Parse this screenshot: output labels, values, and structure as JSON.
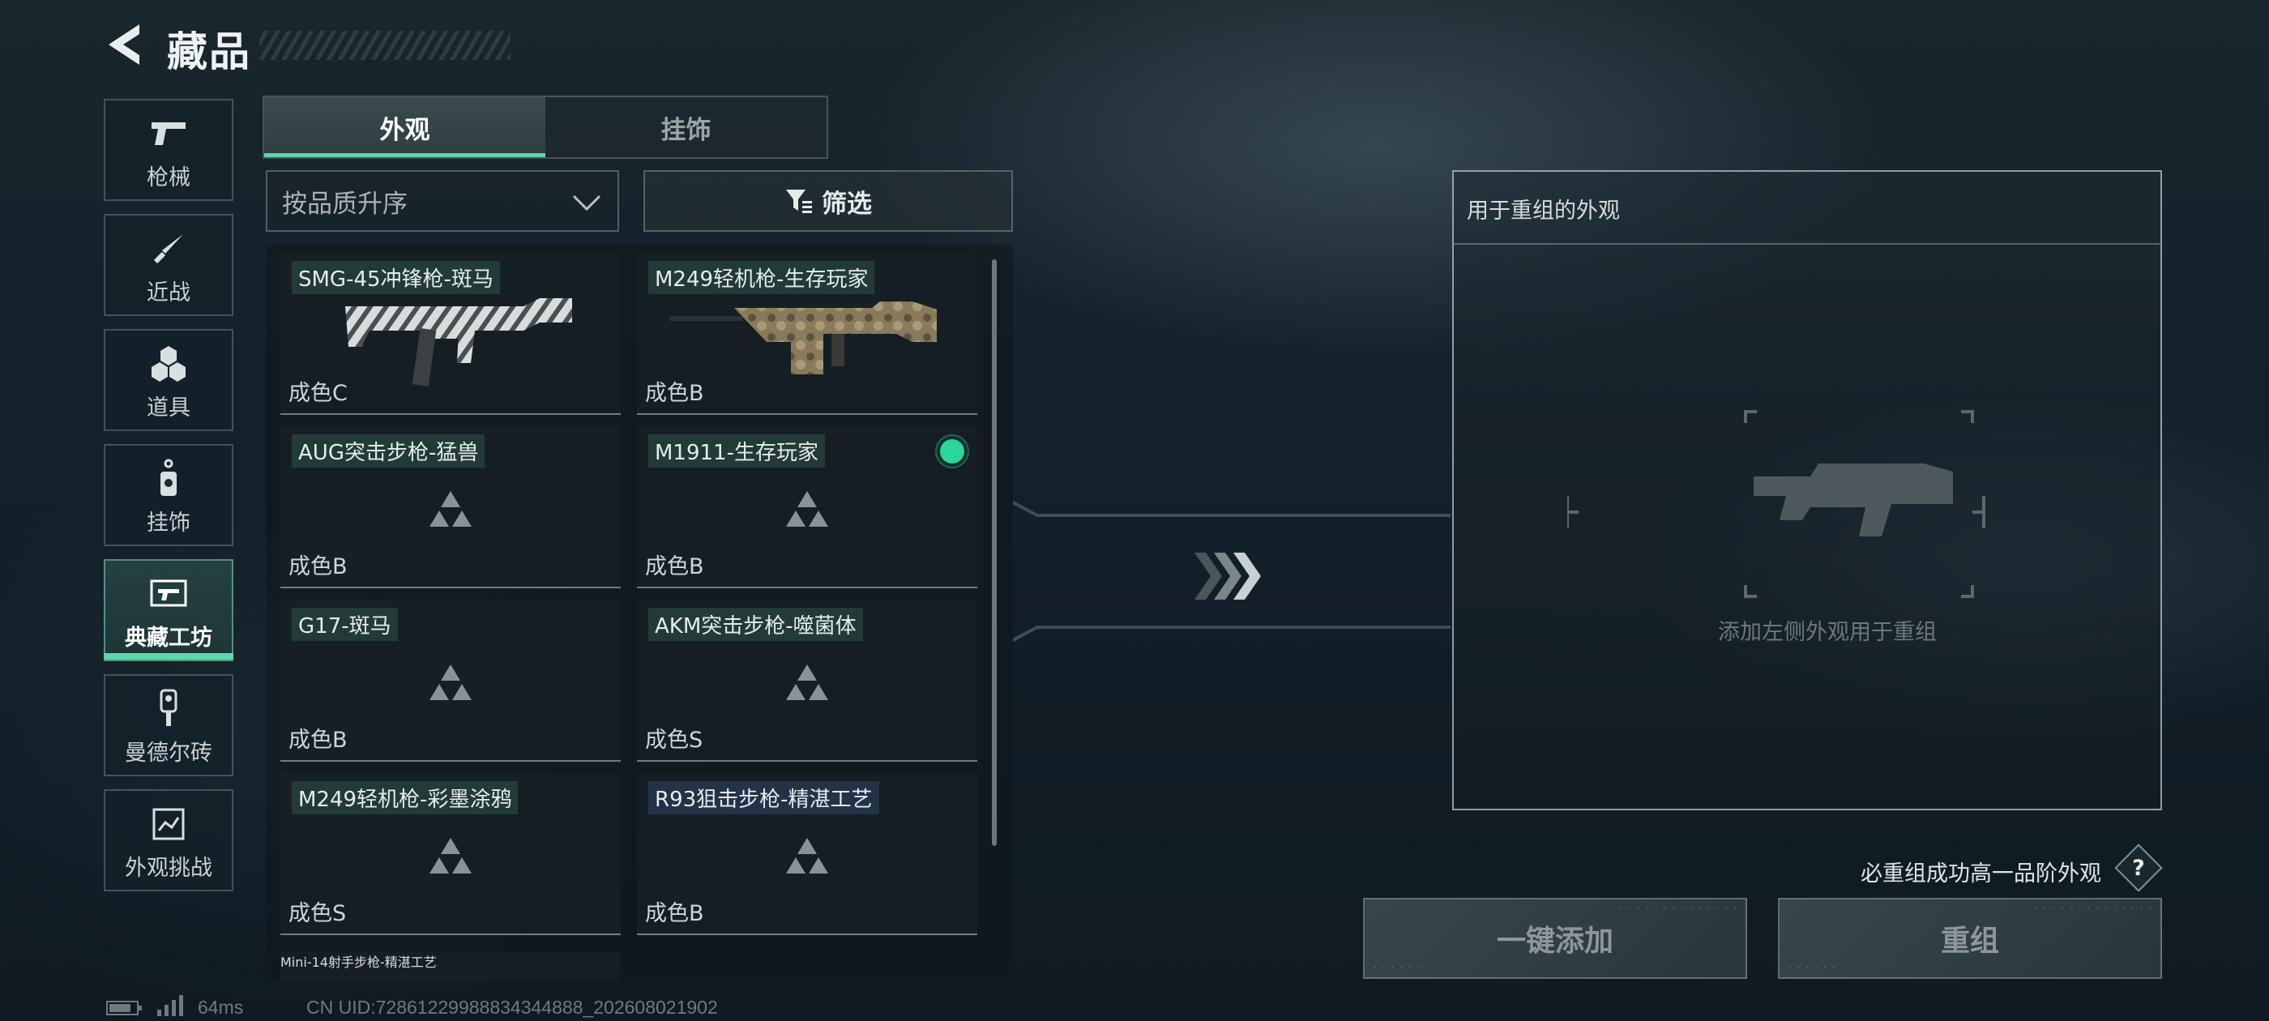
{
  "header": {
    "title": "藏品"
  },
  "nav": [
    {
      "label": "枪械",
      "icon": "pistol-icon"
    },
    {
      "label": "近战",
      "icon": "knife-icon"
    },
    {
      "label": "道具",
      "icon": "grenade-cluster-icon"
    },
    {
      "label": "挂饰",
      "icon": "charm-icon"
    },
    {
      "label": "典藏工坊",
      "icon": "workshop-icon",
      "active": true
    },
    {
      "label": "曼德尔砖",
      "icon": "brick-key-icon"
    },
    {
      "label": "外观挑战",
      "icon": "challenge-icon"
    }
  ],
  "tabs": [
    {
      "label": "外观",
      "active": true
    },
    {
      "label": "挂饰",
      "active": false
    }
  ],
  "sort": {
    "value": "按品质升序"
  },
  "filter": {
    "label": "筛选"
  },
  "items": [
    {
      "name": "SMG-45冲锋枪-斑马",
      "grade": "成色C",
      "image": "smg-zebra"
    },
    {
      "name": "M249轻机枪-生存玩家",
      "grade": "成色B",
      "image": "lmg-survivor"
    },
    {
      "name": "AUG突击步枪-猛兽",
      "grade": "成色B",
      "image": "placeholder"
    },
    {
      "name": "M1911-生存玩家",
      "grade": "成色B",
      "image": "placeholder",
      "selected": true
    },
    {
      "name": "G17-斑马",
      "grade": "成色B",
      "image": "placeholder"
    },
    {
      "name": "AKM突击步枪-噬菌体",
      "grade": "成色S",
      "image": "placeholder"
    },
    {
      "name": "M249轻机枪-彩墨涂鸦",
      "grade": "成色S",
      "image": "placeholder"
    },
    {
      "name": "R93狙击步枪-精湛工艺",
      "grade": "成色B",
      "image": "placeholder",
      "tag_style": "blue"
    }
  ],
  "partial_item": {
    "name": "Mini-14射手步枪-精湛工艺"
  },
  "recombine": {
    "title": "用于重组的外观",
    "hint": "添加左侧外观用于重组"
  },
  "guarantee": {
    "text": "必重组成功高一品阶外观",
    "help": "?"
  },
  "buttons": {
    "add_all": "一键添加",
    "recombine": "重组"
  },
  "status": {
    "ping": "64ms",
    "uid": "CN UID:72861229988834344888_202608021902"
  },
  "colors": {
    "accent": "#5fd6a8",
    "selected": "#2bd69a"
  }
}
